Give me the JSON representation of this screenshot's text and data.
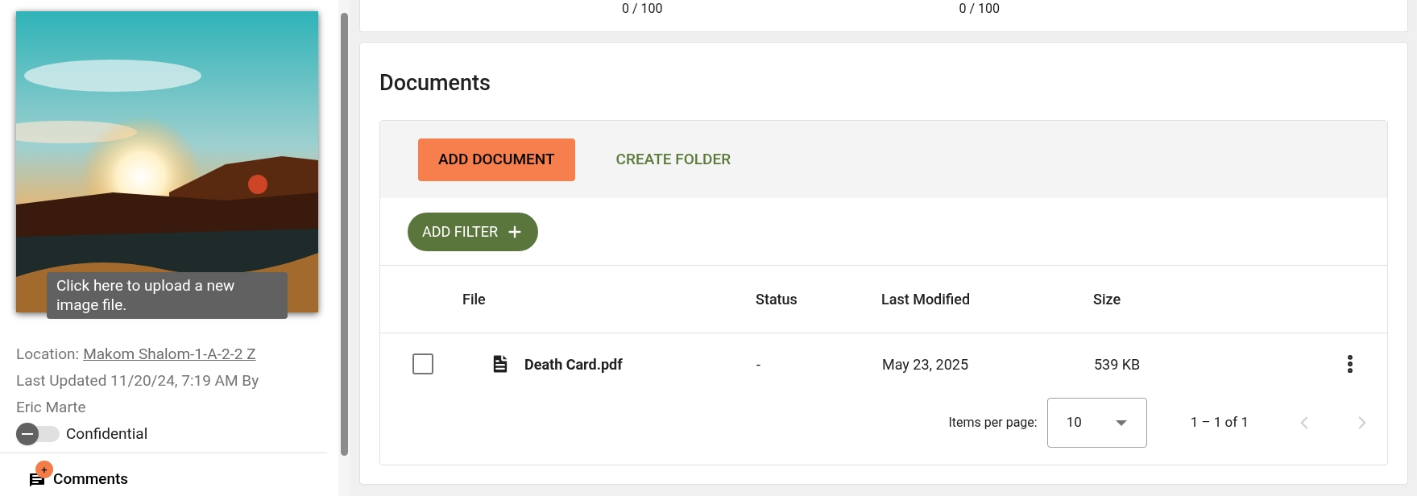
{
  "sidebar": {
    "tooltip": "Click here to upload a new image file.",
    "location_label": "Location:",
    "location_link": "Makom Shalom-1-A-2-2 Z",
    "last_updated": "Last Updated 11/20/24, 7:19 AM By",
    "updated_by": "Eric Marte",
    "confidential": {
      "label": "Confidential",
      "on": false
    },
    "comments": {
      "label": "Comments",
      "badge": "+"
    }
  },
  "top_card": {
    "readings": [
      "0 / 100",
      "0 / 100"
    ]
  },
  "documents": {
    "title": "Documents",
    "actions": [
      {
        "label": "ADD DOCUMENT",
        "kind": "primary"
      },
      {
        "label": "CREATE FOLDER",
        "kind": "text"
      }
    ],
    "filter_button": "ADD FILTER",
    "columns": [
      "File",
      "Status",
      "Last Modified",
      "Size"
    ],
    "rows": [
      {
        "checked": false,
        "file": "Death Card.pdf",
        "status": "-",
        "modified": "May 23, 2025",
        "size": "539 KB"
      }
    ],
    "pagination": {
      "label": "Items per page:",
      "per_page": "10",
      "range": "1 – 1 of 1",
      "prev_disabled": true,
      "next_disabled": true
    }
  }
}
